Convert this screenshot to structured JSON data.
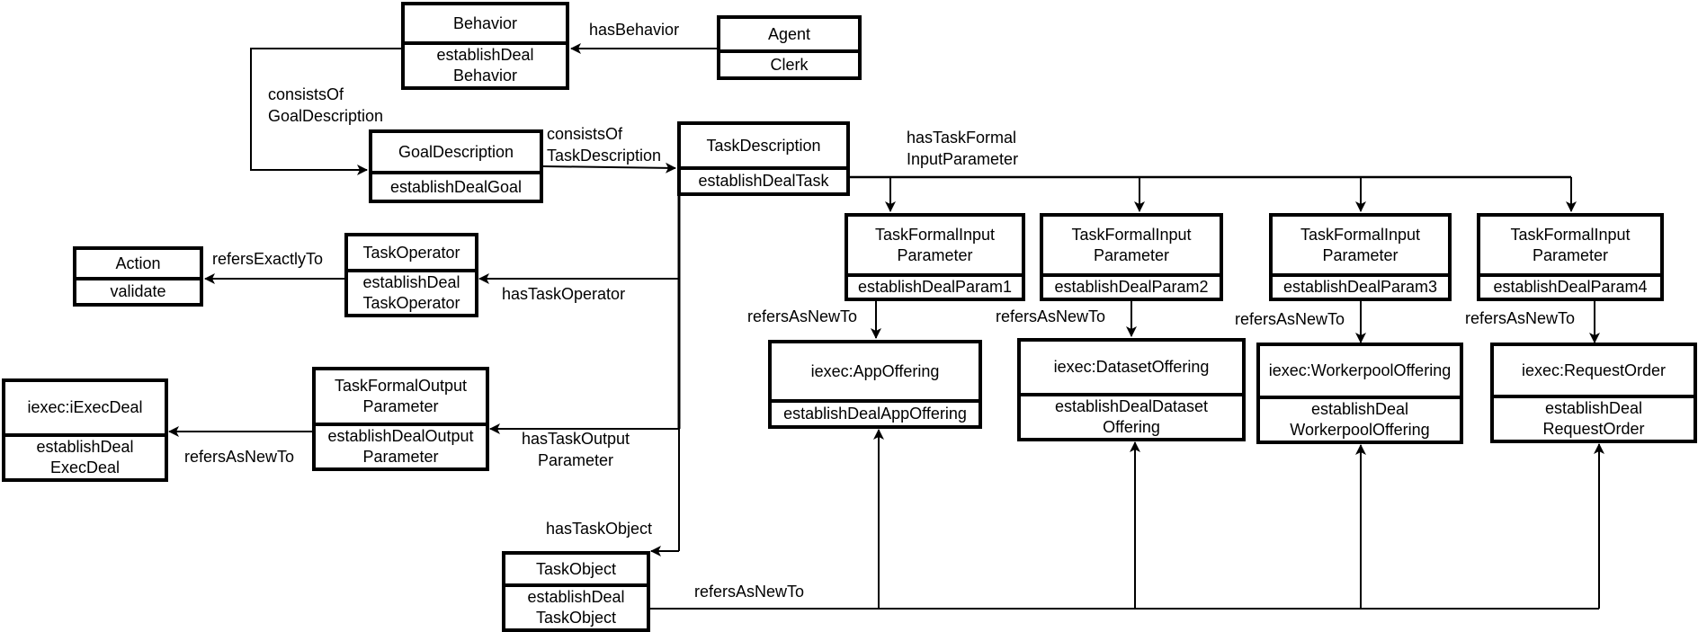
{
  "diagram": {
    "nodes": {
      "behavior": {
        "class": "Behavior",
        "instance": "establishDeal\nBehavior"
      },
      "agent": {
        "class": "Agent",
        "instance": "Clerk"
      },
      "goal": {
        "class": "GoalDescription",
        "instance": "establishDealGoal"
      },
      "task": {
        "class": "TaskDescription",
        "instance": "establishDealTask"
      },
      "action": {
        "class": "Action",
        "instance": "validate"
      },
      "operator": {
        "class": "TaskOperator",
        "instance": "establishDeal\nTaskOperator"
      },
      "execdeal": {
        "class": "iexec:iExecDeal",
        "instance": "establishDeal\nExecDeal"
      },
      "output": {
        "class": "TaskFormalOutput\nParameter",
        "instance": "establishDealOutput\nParameter"
      },
      "taskobject": {
        "class": "TaskObject",
        "instance": "establishDeal\nTaskObject"
      },
      "param1": {
        "class": "TaskFormalInput\nParameter",
        "instance": "establishDealParam1"
      },
      "param2": {
        "class": "TaskFormalInput\nParameter",
        "instance": "establishDealParam2"
      },
      "param3": {
        "class": "TaskFormalInput\nParameter",
        "instance": "establishDealParam3"
      },
      "param4": {
        "class": "TaskFormalInput\nParameter",
        "instance": "establishDealParam4"
      },
      "app": {
        "class": "iexec:AppOffering",
        "instance": "establishDealAppOffering"
      },
      "dataset": {
        "class": "iexec:DatasetOffering",
        "instance": "establishDealDataset\nOffering"
      },
      "workerpool": {
        "class": "iexec:WorkerpoolOffering",
        "instance": "establishDeal\nWorkerpoolOffering"
      },
      "requestorder": {
        "class": "iexec:RequestOrder",
        "instance": "establishDeal\nRequestOrder"
      }
    },
    "edges": {
      "has_behavior": "hasBehavior",
      "consists_of_goal": "consistsOf\nGoalDescription",
      "consists_of_task": "consistsOf\nTaskDescription",
      "has_task_formal_input": "hasTaskFormal\nInputParameter",
      "refers_exactly_to": "refersExactlyTo",
      "has_task_operator": "hasTaskOperator",
      "refers_as_new_to_execdeal": "refersAsNewTo",
      "has_task_output": "hasTaskOutput\nParameter",
      "has_task_object": "hasTaskObject",
      "refers_as_new_to_taskobject": "refersAsNewTo",
      "refers_as_new_to_param1": "refersAsNewTo",
      "refers_as_new_to_param2": "refersAsNewTo",
      "refers_as_new_to_param3": "refersAsNewTo",
      "refers_as_new_to_param4": "refersAsNewTo"
    }
  }
}
